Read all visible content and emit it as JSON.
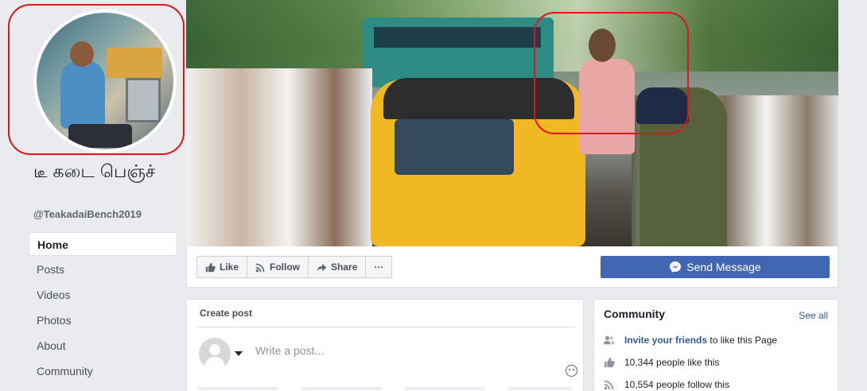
{
  "page": {
    "name": "டீ கடை பெஞ்ச்",
    "handle": "@TeakadaiBench2019"
  },
  "sidebar": {
    "items": [
      {
        "label": "Home",
        "active": true
      },
      {
        "label": "Posts"
      },
      {
        "label": "Videos"
      },
      {
        "label": "Photos"
      },
      {
        "label": "About"
      },
      {
        "label": "Community"
      }
    ]
  },
  "actions": {
    "like": "Like",
    "follow": "Follow",
    "share": "Share",
    "more": "···",
    "send_message": "Send Message"
  },
  "create_post": {
    "title": "Create post",
    "placeholder": "Write a post..."
  },
  "community": {
    "title": "Community",
    "see_all": "See all",
    "invite_link": "Invite your friends",
    "invite_text": " to like this Page",
    "likes_text": "10,344 people like this",
    "follows_text": "10,554 people follow this"
  },
  "colors": {
    "brand_blue": "#4267b2",
    "link_blue": "#365899",
    "highlight_red": "#e0141b",
    "background": "#e9ebee"
  },
  "icons": {
    "like": "thumbs-up-icon",
    "follow": "rss-icon",
    "share": "share-arrow-icon",
    "messenger": "messenger-icon",
    "people": "people-icon",
    "likes": "thumbs-up-icon",
    "follows": "rss-icon",
    "emoji": "emoji-icon"
  }
}
